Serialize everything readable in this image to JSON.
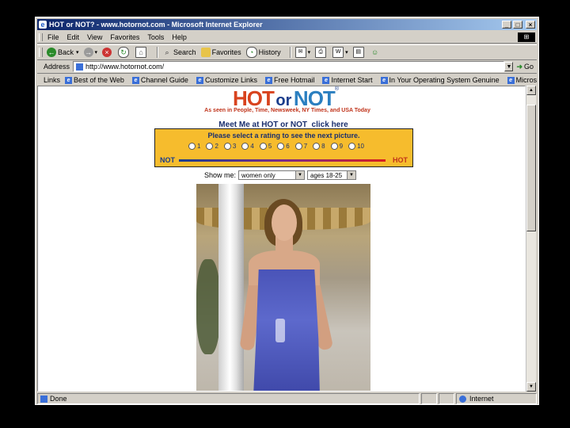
{
  "window": {
    "title": "HOT or NOT? - www.hotornot.com - Microsoft Internet Explorer",
    "controls": {
      "minimize": "_",
      "maximize": "□",
      "close": "×"
    }
  },
  "menu": [
    "File",
    "Edit",
    "View",
    "Favorites",
    "Tools",
    "Help"
  ],
  "toolbar": {
    "back": "Back",
    "search": "Search",
    "favorites": "Favorites",
    "history": "History"
  },
  "address": {
    "label": "Address",
    "value": "http://www.hotornot.com/",
    "go": "Go"
  },
  "links": {
    "label": "Links",
    "items": [
      "Best of the Web",
      "Channel Guide",
      "Customize Links",
      "Free Hotmail",
      "Internet Start",
      "In Your Operating System Genuine",
      "Microsoft"
    ],
    "more": "»"
  },
  "page": {
    "logo": {
      "hot": "HOT",
      "or": "or",
      "not": "NOT",
      "reg": "®"
    },
    "tagline": "As seen in People, Time, Newsweek, NY Times, and USA Today",
    "meet_me": "Meet Me at HOT or NOT",
    "click_here": "click here",
    "rating": {
      "prompt": "Please select a rating to see the next picture.",
      "options": [
        "1",
        "2",
        "3",
        "4",
        "5",
        "6",
        "7",
        "8",
        "9",
        "10"
      ],
      "low_label": "NOT",
      "high_label": "HOT"
    },
    "show_me": {
      "label": "Show me:",
      "gender": "women only",
      "ages": "ages 18-25"
    }
  },
  "status": {
    "text": "Done",
    "zone": "Internet"
  },
  "colors": {
    "hot": "#d8431e",
    "not": "#2b7fc0",
    "rating_box": "#f6bc2d"
  }
}
